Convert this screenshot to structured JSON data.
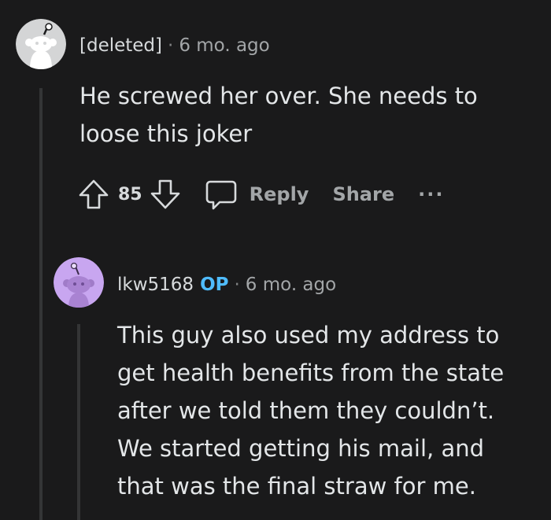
{
  "comments": [
    {
      "username": "[deleted]",
      "separator": "·",
      "timestamp": "6 mo. ago",
      "avatar_icon": "reddit-snoo-avatar-icon",
      "body_lines": [
        "He screwed her over. She needs to",
        "loose this joker"
      ],
      "score": "85",
      "actions": {
        "reply_label": "Reply",
        "share_label": "Share",
        "more_label": "···"
      }
    },
    {
      "username": "lkw5168",
      "op_badge": "OP",
      "separator": "·",
      "timestamp": "6 mo. ago",
      "avatar_icon": "reddit-snoo-avatar-icon",
      "body_lines": [
        "This guy also used my address to",
        "get health benefits from the state",
        "after we told them they couldn’t.",
        "We started getting his mail, and",
        "that was the final straw for me."
      ]
    }
  ],
  "colors": {
    "background": "#1a1a1b",
    "text": "#d7dadc",
    "muted": "#a3a6a8",
    "op_badge": "#4fbcff",
    "avatar_gray": "#d4d5d6",
    "avatar_purple": "#c8a6f0"
  }
}
